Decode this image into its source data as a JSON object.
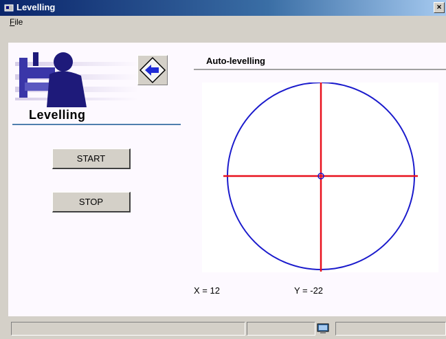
{
  "window": {
    "title": "Levelling"
  },
  "menu": {
    "file": "File"
  },
  "left": {
    "title": "Levelling",
    "start_label": "START",
    "stop_label": "STOP"
  },
  "right": {
    "section_title": "Auto-levelling"
  },
  "readout": {
    "x_text": "X =  12",
    "y_text": "Y =  -22"
  },
  "colors": {
    "circle": "#1a1acc",
    "crosshair": "#e8101c",
    "title_bar": "#0a246a",
    "back_arrow": "#1f2bd6"
  },
  "icons": {
    "window": "app-icon",
    "back": "back-arrow-icon",
    "close": "close-icon",
    "status": "computer-icon"
  }
}
